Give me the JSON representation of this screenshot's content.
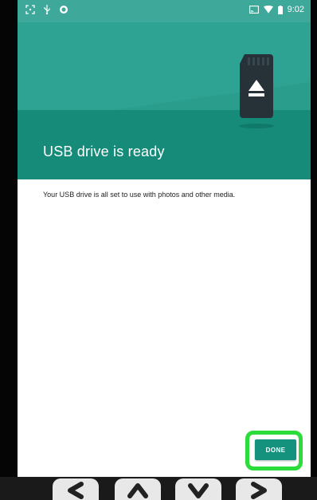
{
  "status_bar": {
    "left_icons": [
      "screenshot-icon",
      "usb-icon",
      "sync-icon"
    ],
    "right_icons": [
      "cast-icon",
      "wifi-icon",
      "battery-icon"
    ],
    "time": "9:02"
  },
  "dialog": {
    "title": "USB drive is ready",
    "message": "Your USB drive is all set to use with photos and other media.",
    "done_label": "DONE"
  },
  "nav_keys": [
    "left-arrow-icon",
    "up-arrow-icon",
    "down-arrow-icon",
    "right-arrow-icon"
  ],
  "colors": {
    "status_bar": "#3ea99a",
    "header_light": "#2fa393",
    "header_dark": "#168b79",
    "accent": "#14927e",
    "highlight": "#2bdc3a"
  }
}
